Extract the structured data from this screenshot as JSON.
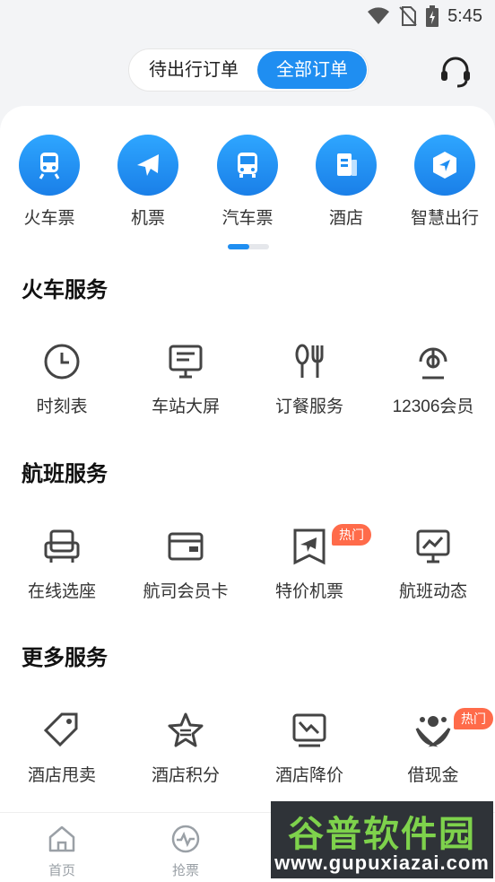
{
  "status": {
    "time": "5:45"
  },
  "header": {
    "tab_pending": "待出行订单",
    "tab_all": "全部订单"
  },
  "top_services": [
    {
      "label": "火车票",
      "icon": "train-icon"
    },
    {
      "label": "机票",
      "icon": "plane-icon"
    },
    {
      "label": "汽车票",
      "icon": "bus-icon"
    },
    {
      "label": "酒店",
      "icon": "hotel-icon"
    },
    {
      "label": "智慧出行",
      "icon": "navigation-icon"
    }
  ],
  "sections": {
    "train": {
      "title": "火车服务",
      "items": [
        {
          "label": "时刻表",
          "icon": "clock-icon"
        },
        {
          "label": "车站大屏",
          "icon": "screen-icon"
        },
        {
          "label": "订餐服务",
          "icon": "cutlery-icon"
        },
        {
          "label": "12306会员",
          "icon": "member-icon"
        }
      ]
    },
    "flight": {
      "title": "航班服务",
      "items": [
        {
          "label": "在线选座",
          "icon": "seat-icon"
        },
        {
          "label": "航司会员卡",
          "icon": "card-icon"
        },
        {
          "label": "特价机票",
          "icon": "ticket-plane-icon",
          "badge": "热门"
        },
        {
          "label": "航班动态",
          "icon": "monitor-icon"
        }
      ]
    },
    "more": {
      "title": "更多服务",
      "items": [
        {
          "label": "酒店甩卖",
          "icon": "tag-icon"
        },
        {
          "label": "酒店积分",
          "icon": "star-icon"
        },
        {
          "label": "酒店降价",
          "icon": "price-drop-icon"
        },
        {
          "label": "借现金",
          "icon": "cash-icon",
          "badge": "热门"
        }
      ]
    }
  },
  "tabbar": [
    {
      "label": "首页",
      "icon": "home-icon"
    },
    {
      "label": "抢票",
      "icon": "pulse-icon"
    }
  ],
  "watermark": {
    "text": "谷普软件园",
    "url": "www.gupuxiazai.com"
  },
  "colors": {
    "accent": "#1f8ef1",
    "hot": "#ff6b4a"
  }
}
